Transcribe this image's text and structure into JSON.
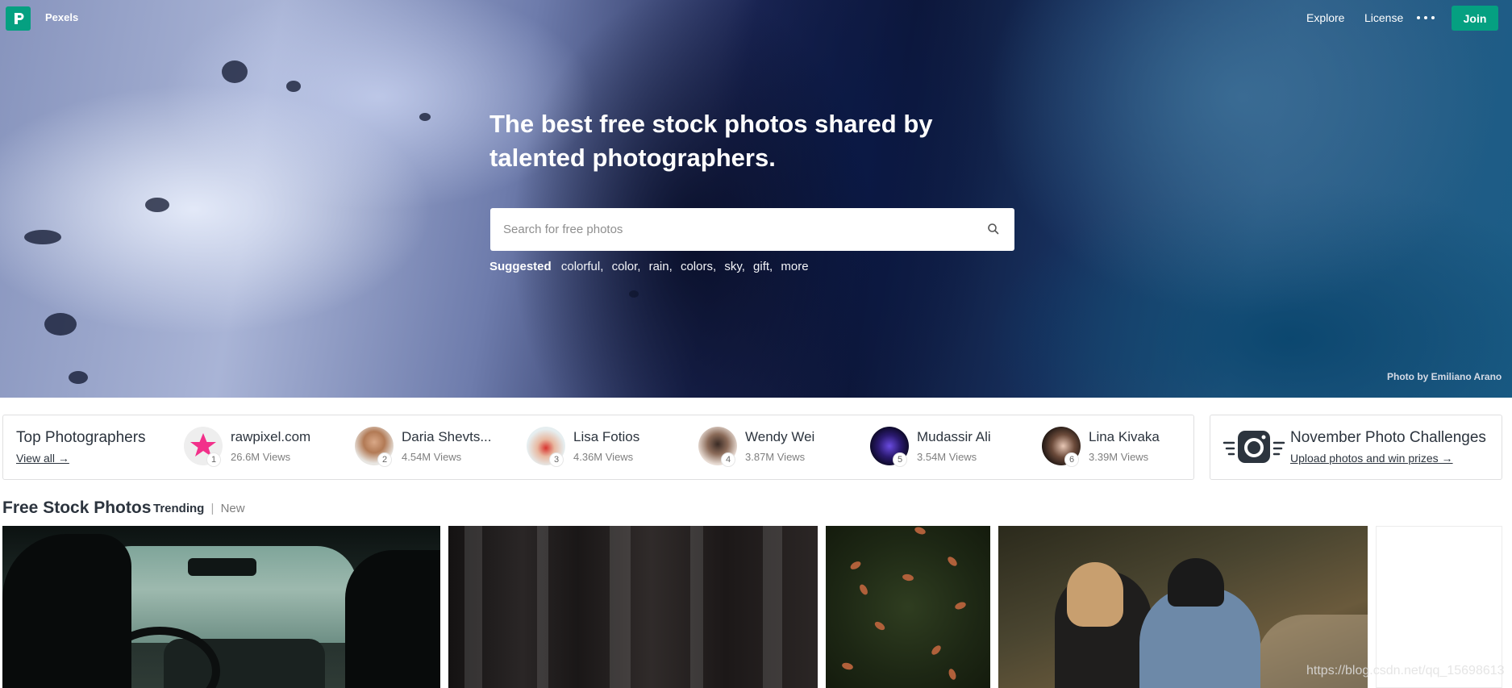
{
  "nav": {
    "brand": "Pexels",
    "explore": "Explore",
    "license": "License",
    "join": "Join",
    "accent_color": "#05a081"
  },
  "hero": {
    "title": "The best free stock photos shared by talented photographers.",
    "search_placeholder": "Search for free photos",
    "suggested_label": "Suggested",
    "suggested_tags": [
      "colorful,",
      "color,",
      "rain,",
      "colors,",
      "sky,",
      "gift,",
      "more"
    ],
    "photo_credit": "Photo by Emiliano Arano"
  },
  "top_photographers": {
    "title": "Top Photographers",
    "view_all": "View all →",
    "items": [
      {
        "name": "rawpixel.com",
        "views": "26.6M Views",
        "rank": "1"
      },
      {
        "name": "Daria Shevts...",
        "views": "4.54M Views",
        "rank": "2"
      },
      {
        "name": "Lisa Fotios",
        "views": "4.36M Views",
        "rank": "3"
      },
      {
        "name": "Wendy Wei",
        "views": "3.87M Views",
        "rank": "4"
      },
      {
        "name": "Mudassir Ali",
        "views": "3.54M Views",
        "rank": "5"
      },
      {
        "name": "Lina Kivaka",
        "views": "3.39M Views",
        "rank": "6"
      }
    ]
  },
  "challenges": {
    "title": "November Photo Challenges",
    "subtitle": "Upload photos and win prizes →"
  },
  "feed": {
    "title": "Free Stock Photos",
    "tab_trending": "Trending",
    "tab_separator": "|",
    "tab_new": "New"
  },
  "watermark": "https://blog.csdn.net/qq_15698613"
}
